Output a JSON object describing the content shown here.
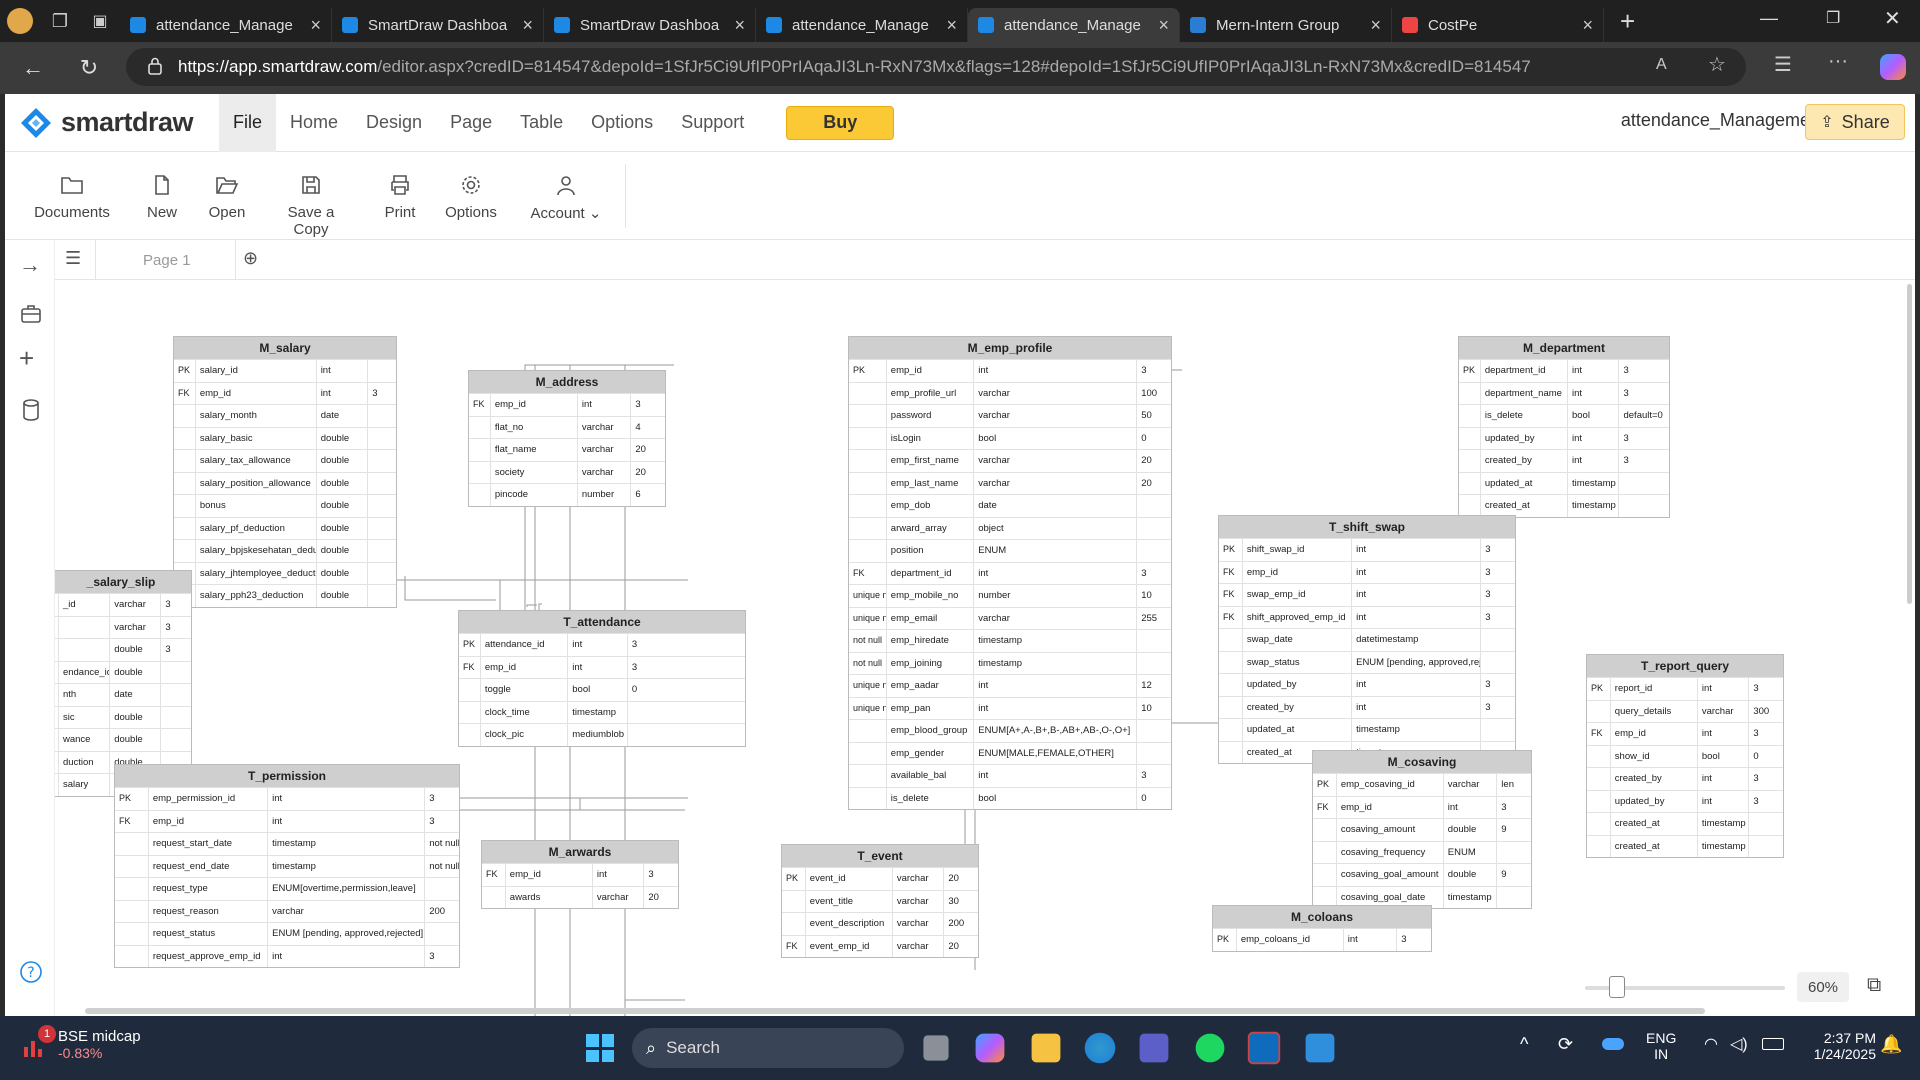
{
  "browser": {
    "tabs": [
      {
        "title": "attendance_Manage",
        "active": false
      },
      {
        "title": "SmartDraw Dashboa",
        "active": false
      },
      {
        "title": "SmartDraw Dashboa",
        "active": false
      },
      {
        "title": "attendance_Manage",
        "active": false
      },
      {
        "title": "attendance_Manage",
        "active": true
      },
      {
        "title": "Mern-Intern Group",
        "active": false
      },
      {
        "title": "CostPe",
        "active": false
      }
    ],
    "url_host": "https://app.smartdraw.com",
    "url_rest": "/editor.aspx?credID=814547&depoId=1SfJr5Ci9UfIP0PrIAqaJI3Ln-RxN73Mx&flags=128#depoId=1SfJr5Ci9UfIP0PrIAqaJI3Ln-RxN73Mx&credID=814547"
  },
  "app": {
    "logo": "smartdraw",
    "menu": [
      "File",
      "Home",
      "Design",
      "Page",
      "Table",
      "Options",
      "Support"
    ],
    "buy": "Buy",
    "doc_title": "attendance_Management",
    "share": "Share",
    "tools": [
      "Documents",
      "New",
      "Open",
      "Save a Copy",
      "Print",
      "Options",
      "Account"
    ],
    "page_tab": "Page 1",
    "zoom": "60%",
    "zoom_level": 0.15
  },
  "tables": [
    {
      "id": "salary",
      "title": "M_salary",
      "rows": [
        [
          "PK",
          "salary_id",
          "int",
          ""
        ],
        [
          "FK",
          "emp_id",
          "int",
          "3"
        ],
        [
          "",
          "salary_month",
          "date",
          ""
        ],
        [
          "",
          "salary_basic",
          "double",
          ""
        ],
        [
          "",
          "salary_tax_allowance",
          "double",
          ""
        ],
        [
          "",
          "salary_position_allowance",
          "double",
          ""
        ],
        [
          "",
          "bonus",
          "double",
          ""
        ],
        [
          "",
          "salary_pf_deduction",
          "double",
          ""
        ],
        [
          "",
          "salary_bpjskesehatan_deduction",
          "double",
          ""
        ],
        [
          "",
          "salary_jhtemployee_deduction",
          "double",
          ""
        ],
        [
          "",
          "salary_pph23_deduction",
          "double",
          ""
        ]
      ]
    },
    {
      "id": "address",
      "title": "M_address",
      "rows": [
        [
          "FK",
          "emp_id",
          "int",
          "3"
        ],
        [
          "",
          "flat_no",
          "varchar",
          "4"
        ],
        [
          "",
          "flat_name",
          "varchar",
          "20"
        ],
        [
          "",
          "society",
          "varchar",
          "20"
        ],
        [
          "",
          "pincode",
          "number",
          "6"
        ]
      ]
    },
    {
      "id": "emp",
      "title": "M_emp_profile",
      "rows": [
        [
          "PK",
          "emp_id",
          "int",
          "3"
        ],
        [
          "",
          "emp_profile_url",
          "varchar",
          "100"
        ],
        [
          "",
          "password",
          "varchar",
          "50"
        ],
        [
          "",
          "isLogin",
          "bool",
          "0"
        ],
        [
          "",
          "emp_first_name",
          "varchar",
          "20"
        ],
        [
          "",
          "emp_last_name",
          "varchar",
          "20"
        ],
        [
          "",
          "emp_dob",
          "date",
          ""
        ],
        [
          "",
          "arward_array",
          "object",
          ""
        ],
        [
          "",
          "position",
          "ENUM",
          ""
        ],
        [
          "FK",
          "department_id",
          "int",
          "3"
        ],
        [
          "unique not null",
          "emp_mobile_no",
          "number",
          "10"
        ],
        [
          "unique not null",
          "emp_email",
          "varchar",
          "255"
        ],
        [
          "not null",
          "emp_hiredate",
          "timestamp",
          ""
        ],
        [
          "not null",
          "emp_joining",
          "timestamp",
          ""
        ],
        [
          "unique not null",
          "emp_aadar",
          "int",
          "12"
        ],
        [
          "unique not null",
          "emp_pan",
          "int",
          "10"
        ],
        [
          "",
          "emp_blood_group",
          "ENUM[A+,A-,B+,B-,AB+,AB-,O-,O+]",
          ""
        ],
        [
          "",
          "emp_gender",
          "ENUM[MALE,FEMALE,OTHER]",
          ""
        ],
        [
          "",
          "available_bal",
          "int",
          "3"
        ],
        [
          "",
          "is_delete",
          "bool",
          "0"
        ]
      ]
    },
    {
      "id": "dept",
      "title": "M_department",
      "rows": [
        [
          "PK",
          "department_id",
          "int",
          "3"
        ],
        [
          "",
          "department_name",
          "int",
          "3"
        ],
        [
          "",
          "is_delete",
          "bool",
          "default=0"
        ],
        [
          "",
          "updated_by",
          "int",
          "3"
        ],
        [
          "",
          "created_by",
          "int",
          "3"
        ],
        [
          "",
          "updated_at",
          "timestamp",
          ""
        ],
        [
          "",
          "created_at",
          "timestamp",
          ""
        ]
      ]
    },
    {
      "id": "swap",
      "title": "T_shift_swap",
      "rows": [
        [
          "PK",
          "shift_swap_id",
          "int",
          "3"
        ],
        [
          "FK",
          "emp_id",
          "int",
          "3"
        ],
        [
          "FK",
          "swap_emp_id",
          "int",
          "3"
        ],
        [
          "FK",
          "shift_approved_emp_id",
          "int",
          "3"
        ],
        [
          "",
          "swap_date",
          "datetimestamp",
          ""
        ],
        [
          "",
          "swap_status",
          "ENUM [pending, approved,rejected]",
          ""
        ],
        [
          "",
          "updated_by",
          "int",
          "3"
        ],
        [
          "",
          "created_by",
          "int",
          "3"
        ],
        [
          "",
          "updated_at",
          "timestamp",
          ""
        ],
        [
          "",
          "created_at",
          "timestamp",
          ""
        ]
      ]
    },
    {
      "id": "slip",
      "title": "_salary_slip",
      "rows": [
        [
          "",
          "_id",
          "varchar",
          "3"
        ],
        [
          "",
          "",
          "varchar",
          "3"
        ],
        [
          "",
          "",
          "double",
          "3"
        ],
        [
          "",
          "endance_id",
          "double",
          ""
        ],
        [
          "",
          "nth",
          "date",
          ""
        ],
        [
          "",
          "sic",
          "double",
          ""
        ],
        [
          "",
          "wance",
          "double",
          ""
        ],
        [
          "",
          "duction",
          "double",
          ""
        ],
        [
          "",
          "salary",
          "double",
          ""
        ]
      ]
    },
    {
      "id": "att",
      "title": "T_attendance",
      "rows": [
        [
          "PK",
          "attendance_id",
          "int",
          "3"
        ],
        [
          "FK",
          "emp_id",
          "int",
          "3"
        ],
        [
          "",
          "toggle",
          "bool",
          "0"
        ],
        [
          "",
          "clock_time",
          "timestamp",
          ""
        ],
        [
          "",
          "clock_pic",
          "mediumblob",
          ""
        ]
      ]
    },
    {
      "id": "report",
      "title": "T_report_query",
      "rows": [
        [
          "PK",
          "report_id",
          "int",
          "3"
        ],
        [
          "",
          "query_details",
          "varchar",
          "300"
        ],
        [
          "FK",
          "emp_id",
          "int",
          "3"
        ],
        [
          "",
          "show_id",
          "bool",
          "0"
        ],
        [
          "",
          "created_by",
          "int",
          "3"
        ],
        [
          "",
          "updated_by",
          "int",
          "3"
        ],
        [
          "",
          "created_at",
          "timestamp",
          ""
        ],
        [
          "",
          "created_at",
          "timestamp",
          ""
        ]
      ]
    },
    {
      "id": "perm",
      "title": "T_permission",
      "rows": [
        [
          "PK",
          "emp_permission_id",
          "int",
          "3"
        ],
        [
          "FK",
          "emp_id",
          "int",
          "3"
        ],
        [
          "",
          "request_start_date",
          "timestamp",
          "not null"
        ],
        [
          "",
          "request_end_date",
          "timestamp",
          "not null"
        ],
        [
          "",
          "request_type",
          "ENUM[overtime,permission,leave]",
          ""
        ],
        [
          "",
          "request_reason",
          "varchar",
          "200"
        ],
        [
          "",
          "request_status",
          "ENUM [pending, approved,rejected]",
          ""
        ],
        [
          "",
          "request_approve_emp_id",
          "int",
          "3"
        ]
      ]
    },
    {
      "id": "awards",
      "title": "M_arwards",
      "rows": [
        [
          "FK",
          "emp_id",
          "int",
          "3"
        ],
        [
          "",
          "awards",
          "varchar",
          "20"
        ]
      ]
    },
    {
      "id": "event",
      "title": "T_event",
      "rows": [
        [
          "PK",
          "event_id",
          "varchar",
          "20"
        ],
        [
          "",
          "event_title",
          "varchar",
          "30"
        ],
        [
          "",
          "event_description",
          "varchar",
          "200"
        ],
        [
          "FK",
          "event_emp_id",
          "varchar",
          "20"
        ]
      ]
    },
    {
      "id": "cosave",
      "title": "M_cosaving",
      "rows": [
        [
          "PK",
          "emp_cosaving_id",
          "varchar",
          "len"
        ],
        [
          "FK",
          "emp_id",
          "int",
          "3"
        ],
        [
          "",
          "cosaving_amount",
          "double",
          "9"
        ],
        [
          "",
          "cosaving_frequency",
          "ENUM",
          ""
        ],
        [
          "",
          "cosaving_goal_amount",
          "double",
          "9"
        ],
        [
          "",
          "cosaving_goal_date",
          "timestamp",
          ""
        ]
      ]
    },
    {
      "id": "coloan",
      "title": "M_coloans",
      "rows": [
        [
          "PK",
          "emp_coloans_id",
          "int",
          "3"
        ]
      ]
    }
  ],
  "taskbar": {
    "widget_title": "BSE midcap",
    "widget_value": "-0.83%",
    "widget_badge": "1",
    "search": "Search",
    "lang1": "ENG",
    "lang2": "IN",
    "time": "2:37 PM",
    "date": "1/24/2025"
  }
}
